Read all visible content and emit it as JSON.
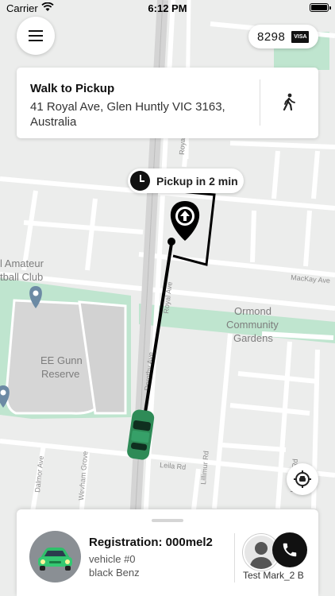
{
  "status_bar": {
    "carrier": "Carrier",
    "time": "6:12 PM"
  },
  "payment": {
    "card_digits": "8298",
    "card_brand": "VISA"
  },
  "walk_card": {
    "title": "Walk to Pickup",
    "address": "41 Royal Ave, Glen Huntly VIC 3163, Australia"
  },
  "pickup_eta": "Pickup in 2 min",
  "map_labels": {
    "park_left_1": "l Amateur",
    "park_left_2": "tball Club",
    "reserve_1": "EE Gunn",
    "reserve_2": "Reserve",
    "ormond_1": "Ormond",
    "ormond_2": "Community",
    "ormond_3": "Gardens",
    "royal_ave": "Royal Ave",
    "royal_top": "Royal",
    "mackay": "MacKay Ave",
    "leila": "Leila Rd",
    "lillimur": "Lillimur Rd",
    "dalmor": "Dalmor Ave",
    "wevham": "Wevham Grove",
    "ulupna": "Ulupna Rd",
    "dorothy": "Dorothy Ave"
  },
  "trip": {
    "registration": "Registration: 000mel2",
    "vehicle_number": "vehicle #0",
    "vehicle_model": "black Benz",
    "driver_name": "Test Mark_2 B"
  },
  "colors": {
    "park_green": "#bfe5cf",
    "route": "#000000",
    "car": "#2e8b57"
  }
}
